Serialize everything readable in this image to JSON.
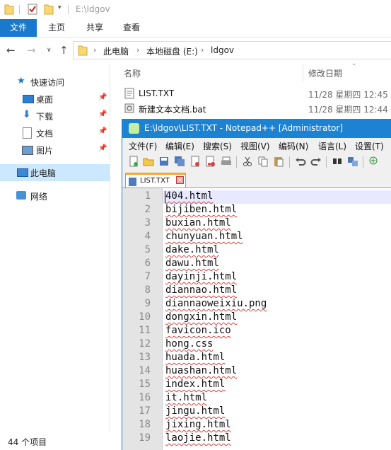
{
  "explorer": {
    "title": "E:\\ldgov",
    "ribbon_tabs": [
      "文件",
      "主页",
      "共享",
      "查看"
    ],
    "breadcrumbs": [
      "此电脑",
      "本地磁盘 (E:)",
      "ldgov"
    ],
    "nav": {
      "quick_access": "快速访问",
      "desktop": "桌面",
      "downloads": "下载",
      "documents": "文档",
      "pictures": "图片",
      "this_pc": "此电脑",
      "network": "网络"
    },
    "columns": {
      "name": "名称",
      "modified": "修改日期"
    },
    "files": [
      {
        "name": "LIST.TXT",
        "modified": "11/28 星期四 12:45"
      },
      {
        "name": "新建文本文档.bat",
        "modified": "11/28 星期四 12:44"
      }
    ],
    "status": "44 个项目",
    "accent": "#1979ca"
  },
  "notepad": {
    "title": "E:\\ldgov\\LIST.TXT - Notepad++ [Administrator]",
    "menu": [
      "文件(F)",
      "编辑(E)",
      "搜索(S)",
      "视图(V)",
      "编码(N)",
      "语言(L)",
      "设置(T)"
    ],
    "tab_label": "LIST.TXT",
    "accent": "#1e82d2",
    "lines": [
      {
        "n": "1",
        "text": "404.html"
      },
      {
        "n": "2",
        "text": "bijiben.html"
      },
      {
        "n": "3",
        "text": "buxian.html"
      },
      {
        "n": "4",
        "text": "chunyuan.html"
      },
      {
        "n": "5",
        "text": "dake.html"
      },
      {
        "n": "6",
        "text": "dawu.html"
      },
      {
        "n": "7",
        "text": "dayinji.html"
      },
      {
        "n": "8",
        "text": "diannao.html"
      },
      {
        "n": "9",
        "text": "diannaoweixiu.png"
      },
      {
        "n": "10",
        "text": "dongxin.html"
      },
      {
        "n": "11",
        "text": "favicon.ico"
      },
      {
        "n": "12",
        "text": "hong.css"
      },
      {
        "n": "13",
        "text": "huada.html"
      },
      {
        "n": "14",
        "text": "huashan.html"
      },
      {
        "n": "15",
        "text": "index.html"
      },
      {
        "n": "16",
        "text": "it.html"
      },
      {
        "n": "17",
        "text": "jingu.html"
      },
      {
        "n": "18",
        "text": "jixing.html"
      },
      {
        "n": "19",
        "text": "laojie.html"
      }
    ]
  }
}
